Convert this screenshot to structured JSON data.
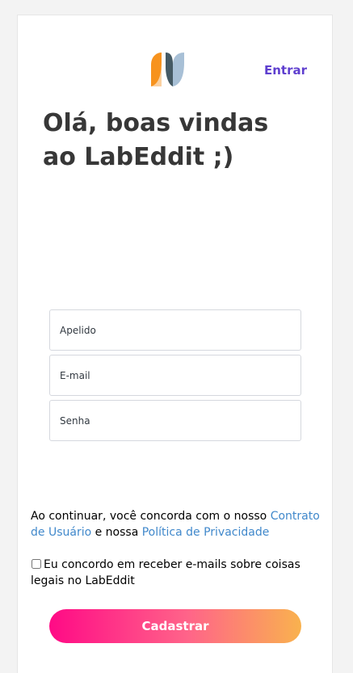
{
  "header": {
    "logo_name": "labeddit-logo",
    "login_label": "Entrar"
  },
  "title": "Olá, boas vindas ao LabEddit ;)",
  "form": {
    "nickname_placeholder": "Apelido",
    "email_placeholder": "E-mail",
    "password_placeholder": "Senha"
  },
  "terms": {
    "prefix": "Ao continuar, você concorda com o nosso ",
    "contract_link": "Contrato de Usuário",
    "middle": " e nossa ",
    "privacy_link": "Política de Privacidade"
  },
  "consent": {
    "label": "Eu concordo em receber e-mails sobre coisas legais no LabEddit",
    "checked": false
  },
  "submit_label": "Cadastrar",
  "colors": {
    "accent": "#5f3fcf",
    "link": "#4088cb",
    "gradient_start": "#ff0a86",
    "gradient_mid": "#ff6489",
    "gradient_end": "#f9b24e",
    "logo_orange": "#f7931e",
    "logo_slate": "#455a64",
    "logo_light": "#a8c0d6"
  }
}
